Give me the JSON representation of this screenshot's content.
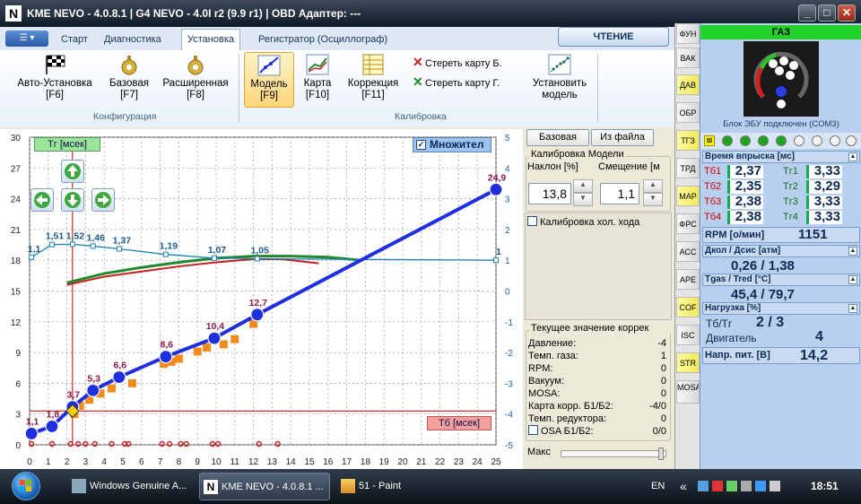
{
  "window": {
    "title": "KME NEVO - 4.0.8.1  |  G4 NEVO - 4.0I r2 (9.9 r1)  |  OBD Адаптер: ---",
    "minimize": "_",
    "maximize": "□",
    "close": "✕"
  },
  "ribbon": {
    "tabs": [
      "Старт",
      "Диагностика",
      "Установка",
      "Регистратор (Осциллограф)"
    ],
    "active_tab": "Установка",
    "read_button": "ЧТЕНИЕ",
    "buttons": [
      {
        "label": "Авто-Установка",
        "key": "[F6]"
      },
      {
        "label": "Базовая",
        "key": "[F7]"
      },
      {
        "label": "Расширенная",
        "key": "[F8]"
      },
      {
        "label": "Модель",
        "key": "[F9]"
      },
      {
        "label": "Карта",
        "key": "[F10]"
      },
      {
        "label": "Коррекция",
        "key": "[F11]"
      },
      {
        "label": "Установить",
        "key": "модель"
      }
    ],
    "erase_b": "Стереть карту Б.",
    "erase_g": "Стереть карту Г.",
    "group_config": "Конфигурация",
    "group_calib": "Калибровка"
  },
  "chart_controls": {
    "tg_label": "Тг [мсек]",
    "tb_label": "Тб [мсек]",
    "multiplier": "Множител",
    "multiplier_checked": "✓"
  },
  "chart_data": {
    "type": "line",
    "x_ticks": [
      "0",
      "1",
      "2",
      "3",
      "4",
      "5",
      "6",
      "7",
      "8",
      "9",
      "10",
      "11",
      "12",
      "13",
      "14",
      "15",
      "16",
      "17",
      "18",
      "19",
      "20",
      "21",
      "22",
      "23",
      "24",
      "25"
    ],
    "y_left_ticks": [
      "30",
      "27",
      "24",
      "21",
      "18",
      "15",
      "12",
      "9",
      "6",
      "3",
      "0"
    ],
    "y_right_ticks": [
      "5",
      "4",
      "3",
      "2",
      "1",
      "0",
      "-1",
      "-2",
      "-3",
      "-4",
      "-5"
    ],
    "xlim": [
      0,
      25
    ],
    "ylim": [
      0,
      30
    ],
    "y2lim": [
      -5,
      5
    ],
    "model_points": {
      "x": [
        0.1,
        1.2,
        2.3,
        3.4,
        4.8,
        7.3,
        9.9,
        12.2,
        25
      ],
      "y": [
        1.1,
        1.8,
        3.7,
        5.3,
        6.6,
        8.6,
        10.4,
        12.7,
        24.9
      ]
    },
    "model_labels": [
      "1,1",
      "1,8",
      "3,7",
      "5,3",
      "6,6",
      "8,6",
      "10,4",
      "12,7",
      "24,9"
    ],
    "correction_points": {
      "x": [
        0.1,
        1.2,
        2.3,
        3.4,
        4.8,
        7.3,
        9.9,
        12.2,
        25
      ],
      "y": [
        1.1,
        1.51,
        1.52,
        1.46,
        1.37,
        1.19,
        1.07,
        1.05,
        1.0
      ]
    },
    "correction_labels": [
      "1,1",
      "1,51",
      "1,52",
      "1,46",
      "1,37",
      "1,19",
      "1,07",
      "1,05",
      "1"
    ],
    "orange_squares": {
      "x": [
        2.4,
        2.7,
        3.2,
        3.8,
        4.4,
        5.5,
        7.2,
        7.6,
        8.0,
        9.0,
        9.5,
        10.4,
        11.0,
        12.0
      ],
      "y": [
        3.0,
        3.8,
        4.4,
        5.0,
        5.5,
        6.0,
        7.9,
        8.1,
        8.4,
        9.1,
        9.5,
        9.8,
        10.3,
        11.8
      ]
    },
    "red_dots_x": [
      0.1,
      1.2,
      2.2,
      2.6,
      3.0,
      3.5,
      4.4,
      5.1,
      5.3,
      7.1,
      7.5,
      8.1,
      8.4,
      9.8,
      10.1,
      12.3,
      13.3
    ],
    "green_line": {
      "x": [
        2.0,
        4,
        6,
        8,
        10,
        12,
        14,
        16,
        17.8
      ],
      "y": [
        15.8,
        16.7,
        17.3,
        17.8,
        18.2,
        18.4,
        18.4,
        18.3,
        18.0
      ]
    },
    "red_line": {
      "x": [
        2.0,
        4,
        6,
        8,
        10,
        12,
        13.5,
        15.5
      ],
      "y": [
        15.6,
        16.4,
        16.9,
        17.4,
        17.8,
        18.1,
        18.1,
        17.7
      ]
    },
    "vertical_marker_x": 2.3,
    "horizontal_marker_y": 3.3
  },
  "calibration": {
    "base_button": "Базовая",
    "file_button": "Из файла",
    "title": "Калибровка Модели",
    "slope_label": "Наклон [%]",
    "offset_label": "Смещение [м",
    "slope_value": "13,8",
    "offset_value": "1,1",
    "idle_label": "Калибровка хол. хода"
  },
  "current": {
    "title": "Текущее значение коррек",
    "rows": [
      {
        "label": "Давление:",
        "value": "-4"
      },
      {
        "label": "Темп. газа:",
        "value": "1"
      },
      {
        "label": "RPM:",
        "value": "0"
      },
      {
        "label": "Вакуум:",
        "value": "0"
      },
      {
        "label": "MOSA:",
        "value": "0"
      },
      {
        "label": "Карта корр. Б1/Б2:",
        "value": "-4/0"
      },
      {
        "label": "Темп. редуктора:",
        "value": "0"
      },
      {
        "label": "OSA Б1/Б2:",
        "value": "0/0"
      }
    ],
    "max_label": "Макс"
  },
  "side_tabs": [
    "ФУН",
    "ВАК",
    "ДАВ",
    "ОБР",
    "ТГЗ",
    "ТРД",
    "МАР",
    "ФРС",
    "АСС",
    "АРЕ",
    "COF",
    "ISC",
    "STR",
    "MOSA"
  ],
  "right_panel": {
    "gas": "ГАЗ",
    "ecu_status": "Блок ЭБУ подключен (COM3)",
    "inj_title": "Время впрыска [мс]",
    "injectors": [
      {
        "b": "Тб1",
        "bv": "2,37",
        "g": "Тг1",
        "gv": "3,33"
      },
      {
        "b": "Тб2",
        "bv": "2,35",
        "g": "Тг2",
        "gv": "3,29"
      },
      {
        "b": "Тб3",
        "bv": "2,38",
        "g": "Тг3",
        "gv": "3,33"
      },
      {
        "b": "Тб4",
        "bv": "2,38",
        "g": "Тг4",
        "gv": "3,33"
      }
    ],
    "rpm_label": "RPM [о/мин]",
    "rpm": "1151",
    "press_title": "Дкол / Дсис [атм]",
    "press": "0,26  /  1,38",
    "temp_title": "Tgas / Tred [°C]",
    "temp": "45,4  /  79,7",
    "load_title": "Нагрузка [%]",
    "load_label": "Тб/Тг",
    "load_value": "2  /  3",
    "engine_label": "Двигатель",
    "engine_value": "4",
    "volt_label": "Напр. пит. [В]",
    "volt": "14,2"
  },
  "taskbar": {
    "items": [
      "Windows Genuine A...",
      "KME NEVO - 4.0.8.1 ...",
      "51 - Paint"
    ],
    "lang": "EN",
    "time": "18:51",
    "chevrons": "«"
  },
  "colors": {
    "model_line": "#1f2fe0",
    "correction_line": "#1f7fb8",
    "green": "#1f8a2c",
    "red": "#c62020",
    "orange": "#f08c1c",
    "marker": "#c00000"
  }
}
